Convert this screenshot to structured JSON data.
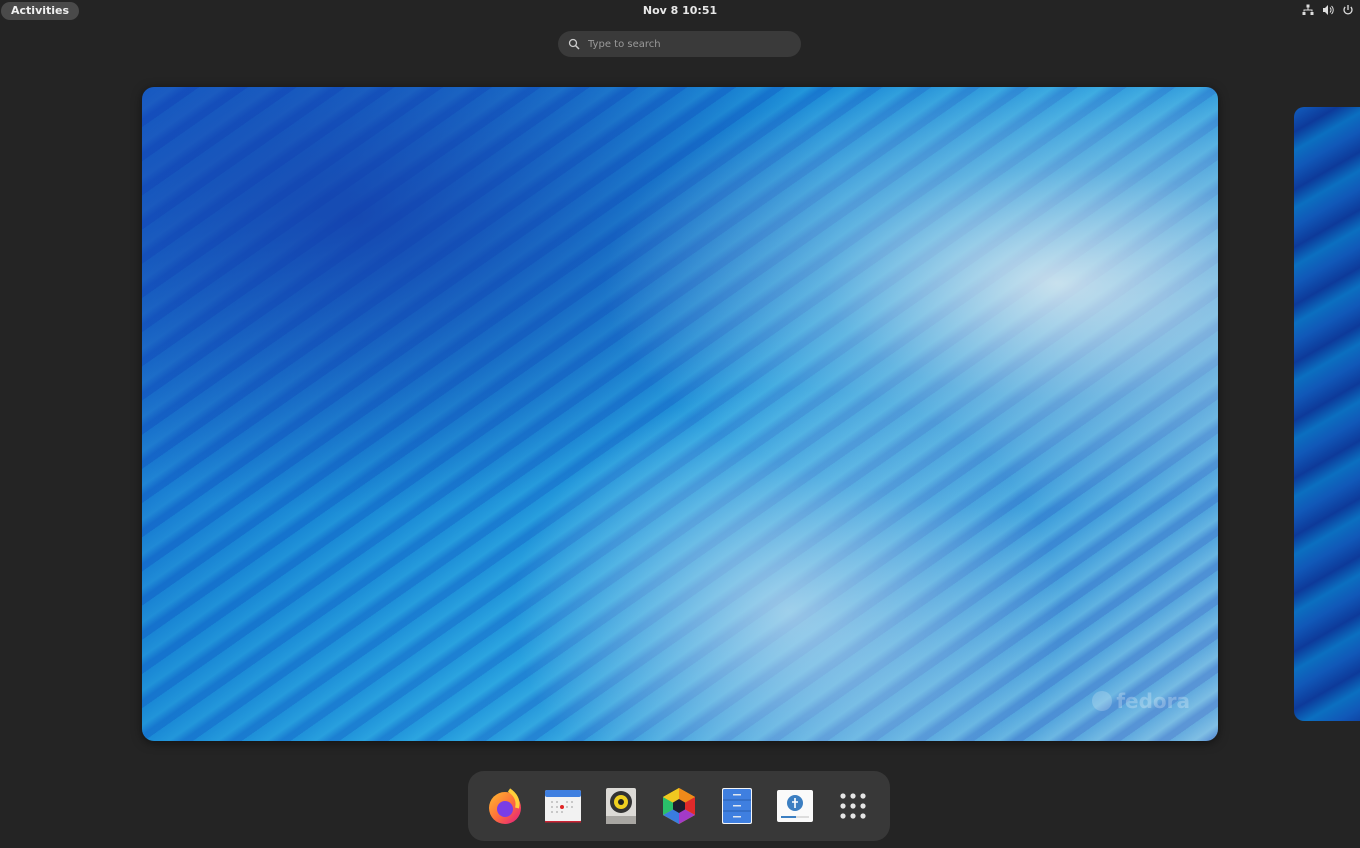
{
  "topbar": {
    "activities_label": "Activities",
    "clock": "Nov 8 10:51",
    "tray": [
      "network-icon",
      "volume-icon",
      "power-icon"
    ]
  },
  "search": {
    "placeholder": "Type to search",
    "value": ""
  },
  "workspace": {
    "watermark": "fedora"
  },
  "dock": {
    "items": [
      {
        "name": "Firefox",
        "icon": "firefox-icon"
      },
      {
        "name": "Calendar",
        "icon": "calendar-icon"
      },
      {
        "name": "Rhythmbox",
        "icon": "speaker-icon"
      },
      {
        "name": "Photos",
        "icon": "aperture-icon"
      },
      {
        "name": "Files",
        "icon": "file-cabinet-icon"
      },
      {
        "name": "Fedora Media Writer",
        "icon": "fedora-installer-icon"
      },
      {
        "name": "Show Apps",
        "icon": "app-grid-icon"
      }
    ]
  }
}
